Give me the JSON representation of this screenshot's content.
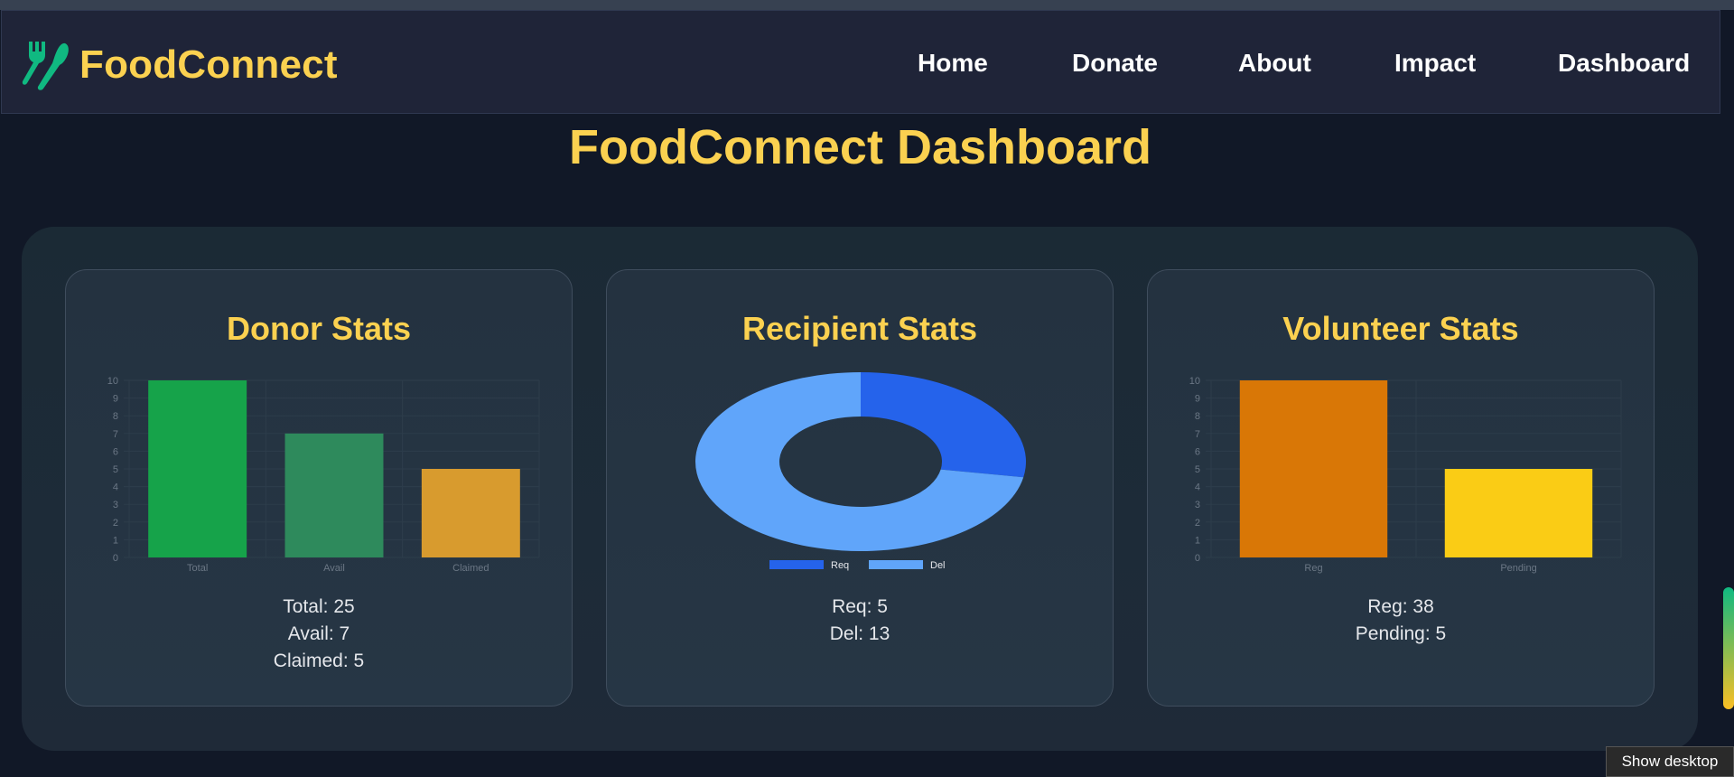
{
  "app": {
    "name": "FoodConnect",
    "logo_icon": "utensils-icon",
    "brand_color": "#fbd150"
  },
  "nav": {
    "items": [
      {
        "label": "Home"
      },
      {
        "label": "Donate"
      },
      {
        "label": "About"
      },
      {
        "label": "Impact"
      },
      {
        "label": "Dashboard"
      }
    ]
  },
  "page": {
    "title": "FoodConnect Dashboard"
  },
  "cards": {
    "donor": {
      "title": "Donor Stats",
      "stats": [
        "Total: 25",
        "Avail: 7",
        "Claimed: 5"
      ]
    },
    "recipient": {
      "title": "Recipient Stats",
      "stats": [
        "Req: 5",
        "Del: 13"
      ]
    },
    "volunteer": {
      "title": "Volunteer Stats",
      "stats": [
        "Reg: 38",
        "Pending: 5"
      ]
    }
  },
  "chart_data": [
    {
      "type": "bar",
      "categories": [
        "Total",
        "Avail",
        "Claimed"
      ],
      "values": [
        10,
        7,
        5
      ],
      "ylim": [
        0,
        10
      ],
      "yticks": [
        0,
        1,
        2,
        3,
        4,
        5,
        6,
        7,
        8,
        9,
        10
      ],
      "colors": [
        "#16a34a",
        "#2e8a5c",
        "#d89b2e"
      ],
      "grid": true,
      "legend": "none"
    },
    {
      "type": "pie",
      "variant": "doughnut",
      "labels": [
        "Req",
        "Del"
      ],
      "values": [
        5,
        13
      ],
      "colors": [
        "#2563eb",
        "#60a5fa"
      ],
      "legend": "bottom"
    },
    {
      "type": "bar",
      "categories": [
        "Reg",
        "Pending"
      ],
      "values": [
        10,
        5
      ],
      "ylim": [
        0,
        10
      ],
      "yticks": [
        0,
        1,
        2,
        3,
        4,
        5,
        6,
        7,
        8,
        9,
        10
      ],
      "colors": [
        "#d97706",
        "#facc15"
      ],
      "grid": true,
      "legend": "none"
    }
  ],
  "taskbar": {
    "show_desktop": "Show desktop"
  },
  "scroll_indicator": {
    "colors": [
      "#10b981",
      "#fbbf24"
    ]
  }
}
